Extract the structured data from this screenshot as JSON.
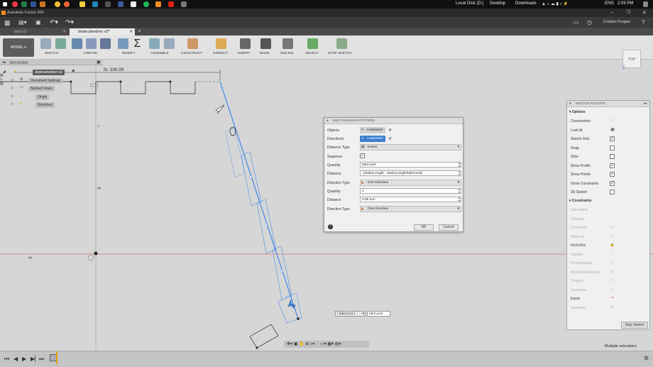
{
  "taskbar": {
    "local_disk": "Local Disk (D:)",
    "desktop": "Desktop",
    "downloads": "Downloads",
    "language": "ENG",
    "time": "2:09 PM"
  },
  "app": {
    "title": "Autodesk Fusion 360",
    "user": "Cristian Prugari"
  },
  "tabs": [
    {
      "label": "dod v1*"
    },
    {
      "label": "dodecahedron v2*"
    }
  ],
  "toolbar": {
    "model_label": "MODEL",
    "groups": [
      "SKETCH",
      "CREATE",
      "MODIFY",
      "ASSEMBLE",
      "CONSTRUCT",
      "INSPECT",
      "INSERT",
      "MAKE",
      "ADD-INS",
      "SELECT",
      "STOP SKETCH"
    ]
  },
  "browser": {
    "title": "BROWSER",
    "root": "dodecahedron v2",
    "items": [
      "Document Settings",
      "Named Views",
      "Origin",
      "Sketches"
    ]
  },
  "viewcube": {
    "label": "TOP"
  },
  "canvas": {
    "dimension": "fx: 100.00",
    "inline_edit": "/ tabCount )",
    "inline_value": "tabCount"
  },
  "dialog": {
    "title": "RECTANGULAR PATTERN",
    "rows": {
      "objects_label": "Objects",
      "objects_value": "4 selected",
      "directions_label": "Direction/s",
      "directions_value": "1 selected",
      "distance_type_label": "Distance Type",
      "distance_type_value": "Extent",
      "suppress_label": "Suppress",
      "quantity_label": "Quantity",
      "quantity_value": "tabCount",
      "distance_label": "Distance",
      "distance_value": "-(dodecLength - dodecLength/tabCount)",
      "direction_type_label": "Direction Type",
      "direction_type_value": "One Direction",
      "quantity2_label": "Quantity",
      "quantity2_value": "1",
      "distance2_label": "Distance",
      "distance2_value": "0.00 mm",
      "direction_type2_label": "Direction Type",
      "direction_type2_value": "One Direction"
    },
    "ok_label": "OK",
    "cancel_label": "Cancel"
  },
  "palette": {
    "title": "SKETCH PALETTE",
    "options_title": "Options",
    "options": [
      {
        "label": "Construction",
        "kind": "icon"
      },
      {
        "label": "Look At",
        "kind": "icon"
      },
      {
        "label": "Sketch Grid",
        "kind": "checked"
      },
      {
        "label": "Snap",
        "kind": "unchecked"
      },
      {
        "label": "Slice",
        "kind": "unchecked"
      },
      {
        "label": "Show Profile",
        "kind": "checked"
      },
      {
        "label": "Show Points",
        "kind": "checked"
      },
      {
        "label": "Show Constraints",
        "kind": "checked"
      },
      {
        "label": "3D Sketch",
        "kind": "unchecked"
      }
    ],
    "constraints_title": "Constraints",
    "constraints": [
      {
        "label": "Coincident",
        "enabled": false
      },
      {
        "label": "Collinear",
        "enabled": false
      },
      {
        "label": "Concentric",
        "enabled": false
      },
      {
        "label": "Midpoint",
        "enabled": false
      },
      {
        "label": "Fix/UnFix",
        "enabled": true
      },
      {
        "label": "Parallel",
        "enabled": false
      },
      {
        "label": "Perpendicular",
        "enabled": false
      },
      {
        "label": "Horizontal/Vertical",
        "enabled": false
      },
      {
        "label": "Tangent",
        "enabled": false
      },
      {
        "label": "Curvature",
        "enabled": false
      },
      {
        "label": "Equal",
        "enabled": true
      },
      {
        "label": "Symmetry",
        "enabled": false
      }
    ],
    "stop_sketch": "Stop Sketch"
  },
  "status": {
    "selection": "Multiple selections"
  },
  "colors": {
    "accent": "#3c7fd0",
    "axis_red": "#e06060",
    "axis_green": "#7ec07e",
    "sketch_line": "#4a8ee6"
  }
}
